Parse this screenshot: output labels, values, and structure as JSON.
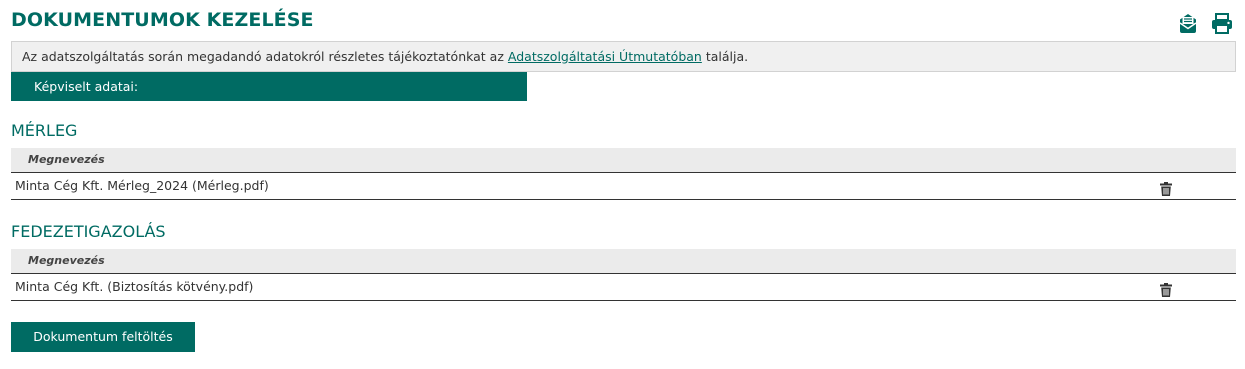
{
  "page": {
    "title": "DOKUMENTUMOK KEZELÉSE"
  },
  "header_icons": [
    {
      "name": "mail-icon",
      "color": "#006b63"
    },
    {
      "name": "print-icon",
      "color": "#006b63"
    }
  ],
  "info": {
    "text_before": "Az adatszolgáltatás során megadandó adatokról részletes tájékoztatónkat az ",
    "link_text": "Adatszolgáltatási Útmutatóban",
    "text_after": " találja."
  },
  "represented": {
    "label": "Képviselt adatai:"
  },
  "sections": [
    {
      "title": "MÉRLEG",
      "column_header": "Megnevezés",
      "rows": [
        {
          "filename": "Minta Cég Kft. Mérleg_2024 (Mérleg.pdf)",
          "action_icon": "trash-icon"
        }
      ]
    },
    {
      "title": "FEDEZETIGAZOLÁS",
      "column_header": "Megnevezés",
      "rows": [
        {
          "filename": "Minta Cég Kft. (Biztosítás kötvény.pdf)",
          "action_icon": "trash-icon"
        }
      ]
    }
  ],
  "actions": {
    "upload_label": "Dokumentum feltöltés"
  },
  "colors": {
    "brand": "#006b63",
    "info_bg": "#f0f0f0",
    "table_header_bg": "#ebebeb"
  }
}
